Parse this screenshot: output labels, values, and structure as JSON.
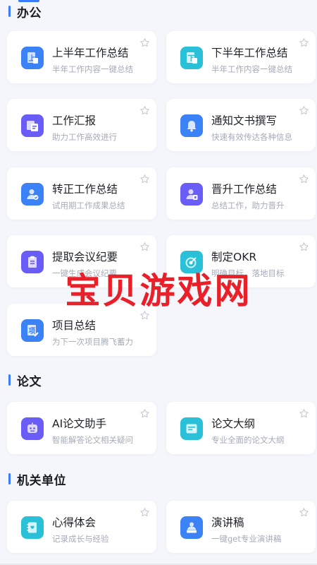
{
  "sections": [
    {
      "title": "办公",
      "cards": [
        {
          "title": "上半年工作总结",
          "subtitle": "半年工作内容一键总结",
          "icon": "document-up-icon",
          "color": "#3b82f6"
        },
        {
          "title": "下半年工作总结",
          "subtitle": "半年工作内容一键总结",
          "icon": "document-down-icon",
          "color": "#29c0d8"
        },
        {
          "title": "工作汇报",
          "subtitle": "助力工作高效进行",
          "icon": "report-icon",
          "color": "#6a5cf6"
        },
        {
          "title": "通知文书撰写",
          "subtitle": "快速有效传达各种信息",
          "icon": "bell-icon",
          "color": "#3b82f6"
        },
        {
          "title": "转正工作总结",
          "subtitle": "试用期工作成果总结",
          "icon": "user-check-icon",
          "color": "#3b82f6"
        },
        {
          "title": "晋升工作总结",
          "subtitle": "总结工作，助力晋升",
          "icon": "user-promote-icon",
          "color": "#6a5cf6"
        },
        {
          "title": "提取会议纪要",
          "subtitle": "一键生成会议纪要",
          "icon": "clipboard-icon",
          "color": "#6a5cf6"
        },
        {
          "title": "制定OKR",
          "subtitle": "明确目标，落地目标",
          "icon": "target-icon",
          "color": "#29c0d8"
        },
        {
          "title": "项目总结",
          "subtitle": "为下一次项目腾飞蓄力",
          "icon": "project-icon",
          "color": "#3b82f6"
        }
      ]
    },
    {
      "title": "论文",
      "cards": [
        {
          "title": "AI论文助手",
          "subtitle": "智能解答论文相关疑问",
          "icon": "ai-robot-icon",
          "color": "#6a5cf6"
        },
        {
          "title": "论文大纲",
          "subtitle": "专业全面的论文大纲",
          "icon": "outline-icon",
          "color": "#29c0d8"
        }
      ]
    },
    {
      "title": "机关单位",
      "cards": [
        {
          "title": "心得体会",
          "subtitle": "记录成长与经验",
          "icon": "notebook-icon",
          "color": "#29c0d8"
        },
        {
          "title": "演讲稿",
          "subtitle": "一键get专业演讲稿",
          "icon": "speaker-icon",
          "color": "#3b82f6"
        }
      ]
    }
  ],
  "watermark": "宝贝游戏网",
  "colors": {
    "accent": "#3b7bff",
    "star": "#c7cbd4"
  }
}
